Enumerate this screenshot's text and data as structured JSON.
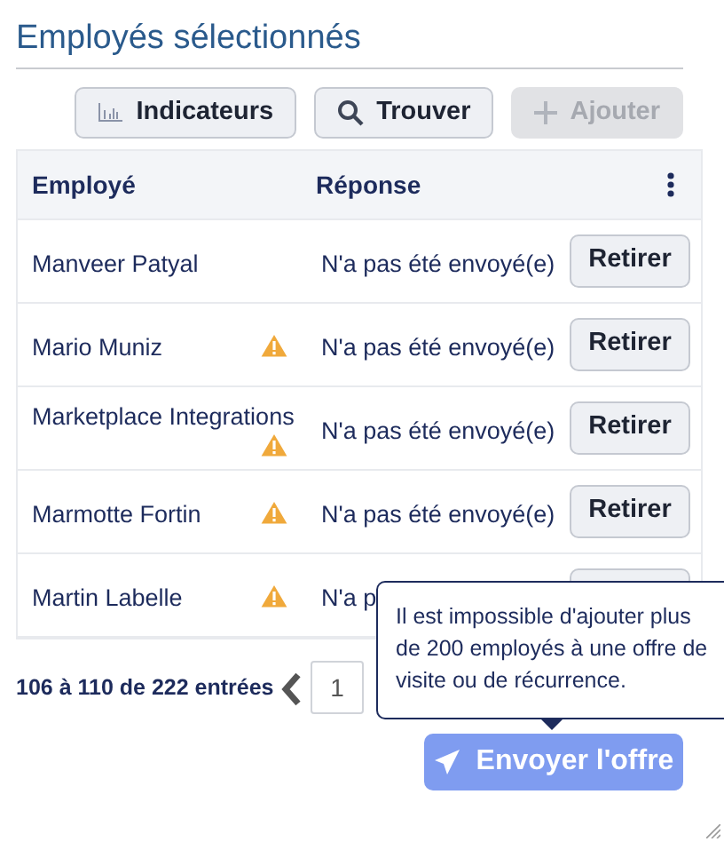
{
  "title": "Employés sélectionnés",
  "toolbar": [
    {
      "kind": "chart",
      "label": "Indicateurs",
      "disabled": false
    },
    {
      "kind": "search",
      "label": "Trouver",
      "disabled": false
    },
    {
      "kind": "add",
      "label": "Ajouter",
      "disabled": true
    }
  ],
  "table": {
    "columns": [
      "Employé",
      "Réponse"
    ],
    "rows": [
      {
        "employee": "Manveer Patyal",
        "warning": false,
        "response": "N'a pas été envoyé(e)",
        "action": "Retirer"
      },
      {
        "employee": "Mario Muniz",
        "warning": true,
        "response": "N'a pas été envoyé(e)",
        "action": "Retirer"
      },
      {
        "employee": "Marketplace Integrations",
        "warning": true,
        "response": "N'a pas été envoyé(e)",
        "action": "Retirer"
      },
      {
        "employee": "Marmotte Fortin",
        "warning": true,
        "response": "N'a pas été envoyé(e)",
        "action": "Retirer"
      },
      {
        "employee": "Martin Labelle",
        "warning": true,
        "response": "N'a p"
      }
    ]
  },
  "pagination": {
    "summary": "106 à 110 de 222 entrées",
    "page": "1"
  },
  "tooltip": "Il est impossible d'ajouter plus de 200 employés à une offre de visite ou de récurrence.",
  "send_button": {
    "label": "Envoyer l'offre",
    "disabled": true
  }
}
